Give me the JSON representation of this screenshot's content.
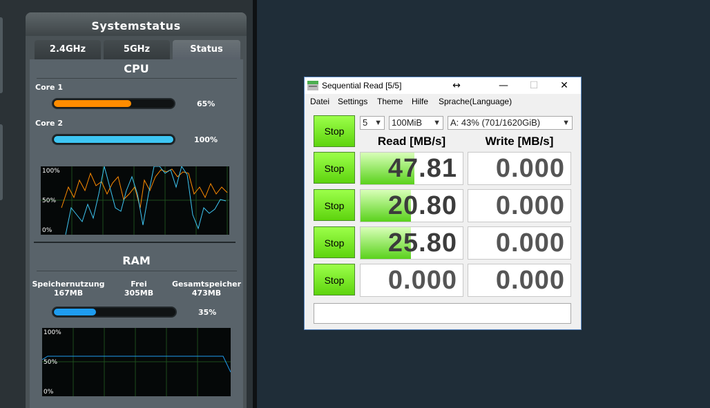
{
  "router": {
    "title": "Systemstatus",
    "tabs": [
      {
        "label": "2.4GHz",
        "active": false
      },
      {
        "label": "5GHz",
        "active": false
      },
      {
        "label": "Status",
        "active": true
      }
    ],
    "cpu": {
      "heading": "CPU",
      "cores": [
        {
          "label": "Core 1",
          "percent_text": "65%",
          "level": 0.65,
          "color": "#ff8c00"
        },
        {
          "label": "Core 2",
          "percent_text": "100%",
          "level": 1.0,
          "color": "#3ec6f3"
        }
      ],
      "graph_labels": [
        "100%",
        "50%",
        "0%"
      ]
    },
    "ram": {
      "heading": "RAM",
      "columns": [
        {
          "label": "Speichernutzung",
          "value": "167MB"
        },
        {
          "label": "Frei",
          "value": "305MB"
        },
        {
          "label": "Gesamtspeicher",
          "value": "473MB"
        }
      ],
      "percent_text": "35%",
      "level": 0.35,
      "color": "#1e9cf0",
      "graph_labels": [
        "100%",
        "50%",
        "0%"
      ]
    }
  },
  "cdm": {
    "window_title": "Sequential Read [5/5]",
    "resize_glyph": "↔",
    "controls": {
      "minimize": "—",
      "maximize": "☐",
      "close": "✕"
    },
    "menu": [
      "Datei",
      "Settings",
      "Theme",
      "Hilfe",
      "Sprache(Language)"
    ],
    "selects": {
      "count": "5",
      "size": "100MiB",
      "drive": "A: 43% (701/1620GiB)"
    },
    "headers": {
      "read": "Read [MB/s]",
      "write": "Write [MB/s]"
    },
    "stop_label": "Stop",
    "rows": [
      {
        "read": "47.81",
        "write": "0.000",
        "read_level": 0.53
      },
      {
        "read": "20.80",
        "write": "0.000",
        "read_level": 0.49
      },
      {
        "read": "25.80",
        "write": "0.000",
        "read_level": 0.49
      },
      {
        "read": "0.000",
        "write": "0.000",
        "read_level": 0
      }
    ],
    "comment": ""
  }
}
